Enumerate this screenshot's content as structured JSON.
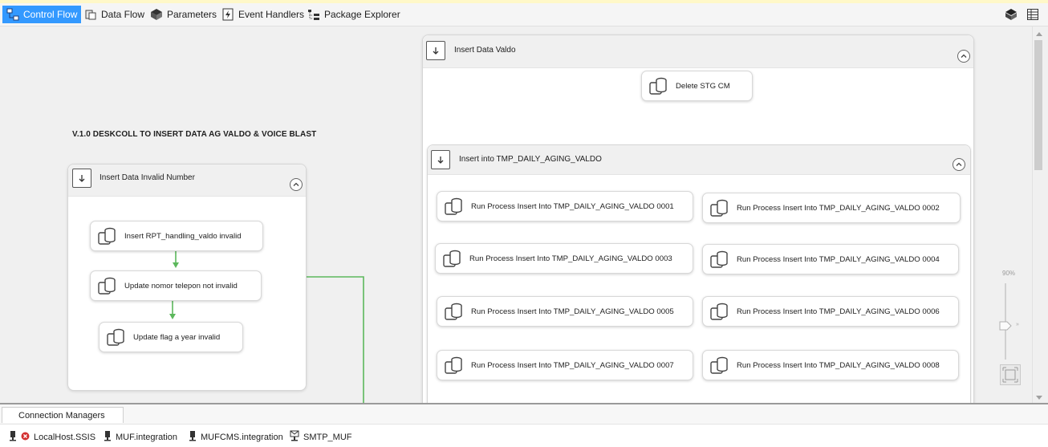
{
  "tabs": [
    {
      "label": "Control Flow",
      "icon": "control-flow-icon",
      "active": true
    },
    {
      "label": "Data Flow",
      "icon": "data-flow-icon",
      "active": false
    },
    {
      "label": "Parameters",
      "icon": "parameters-icon",
      "active": false
    },
    {
      "label": "Event Handlers",
      "icon": "event-handlers-icon",
      "active": false
    },
    {
      "label": "Package Explorer",
      "icon": "package-explorer-icon",
      "active": false
    }
  ],
  "canvas": {
    "heading": "V.1.0 DESKCOLL TO INSERT DATA AG VALDO & VOICE BLAST",
    "left_container": {
      "title": "Insert Data Invalid Number",
      "tasks": [
        "Insert RPT_handling_valdo invalid",
        "Update nomor telepon not invalid",
        "Update flag a year invalid"
      ]
    },
    "right_container": {
      "title": "Insert Data Valdo",
      "task": "Delete STG CM",
      "inner": {
        "title": "Insert into TMP_DAILY_AGING_VALDO",
        "tasks": [
          "Run Process  Insert Into TMP_DAILY_AGING_VALDO 0001",
          "Run Process  Insert Into TMP_DAILY_AGING_VALDO 0002",
          "Run Process  Insert Into TMP_DAILY_AGING_VALDO 0003",
          "Run Process  Insert Into TMP_DAILY_AGING_VALDO 0004",
          "Run Process  Insert Into TMP_DAILY_AGING_VALDO 0005",
          "Run Process  Insert Into TMP_DAILY_AGING_VALDO 0006",
          "Run Process  Insert Into TMP_DAILY_AGING_VALDO 0007",
          "Run Process  Insert Into TMP_DAILY_AGING_VALDO 0008"
        ]
      }
    }
  },
  "zoom": {
    "level_label": "90%"
  },
  "colors": {
    "accent": "#3399ff",
    "precedence": "#5cb85c",
    "canvas": "#f0f0f0"
  },
  "connection_managers": {
    "tab_label": "Connection Managers",
    "items": [
      {
        "label": "LocalHost.SSIS",
        "icon": "connection-error-icon"
      },
      {
        "label": "MUF.integration",
        "icon": "connection-icon"
      },
      {
        "label": "MUFCMS.integration",
        "icon": "connection-icon"
      },
      {
        "label": "SMTP_MUF",
        "icon": "smtp-connection-icon"
      }
    ]
  }
}
